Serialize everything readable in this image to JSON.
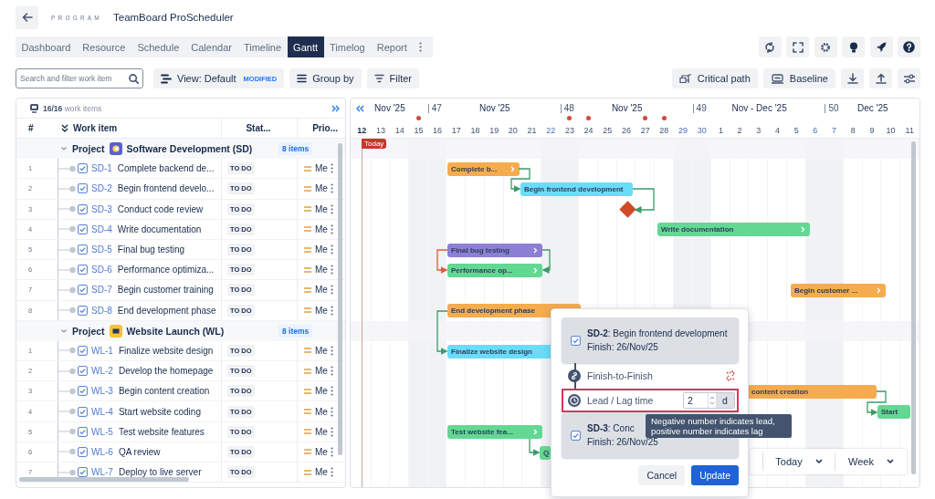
{
  "header": {
    "eyebrow": "PROGRAM",
    "title": "TeamBoard ProScheduler"
  },
  "tabs": [
    {
      "label": "Dashboard",
      "selected": false
    },
    {
      "label": "Resource",
      "selected": false
    },
    {
      "label": "Schedule",
      "selected": false
    },
    {
      "label": "Calendar",
      "selected": false
    },
    {
      "label": "Timeline",
      "selected": false
    },
    {
      "label": "Gantt",
      "selected": true
    },
    {
      "label": "Timelog",
      "selected": false
    },
    {
      "label": "Report",
      "selected": false
    }
  ],
  "toolbar": {
    "search": {
      "placeholder": "Search and filter work item"
    },
    "view": {
      "label": "View: Default",
      "badge": "MODIFIED"
    },
    "buttons": [
      {
        "kind": "group",
        "label": "Group by"
      },
      {
        "kind": "filter",
        "label": "Filter"
      }
    ],
    "right_buttons": [
      {
        "kind": "critical-path",
        "label": "Critical path"
      },
      {
        "kind": "baseline",
        "label": "Baseline"
      }
    ]
  },
  "grid": {
    "summary": "**16/16** work items",
    "columns": [
      "#",
      "Work item",
      "Stat...",
      "Prio..."
    ],
    "groups": [
      {
        "label": "Project",
        "name": "Software Development (SD)",
        "count": "8 items",
        "expanded": true,
        "color": "#5a5fd0",
        "items": [
          {
            "number": "1",
            "key": "SD-1",
            "title": "Complete backend de...",
            "status": "TO DO",
            "priority": "Me",
            "bar": {
              "kind": "task",
              "label": "Complete b...",
              "color": "#f5ac4e"
            }
          },
          {
            "number": "2",
            "key": "SD-2",
            "title": "Begin frontend develo...",
            "status": "TO DO",
            "priority": "Me",
            "bar": {
              "kind": "task",
              "label": "Begin frontend development",
              "color": "#6adcf8"
            }
          },
          {
            "number": "3",
            "key": "SD-3",
            "title": "Conduct code review",
            "status": "TO DO",
            "priority": "Me",
            "bar": {
              "kind": "milestone",
              "color": "#d04a2a"
            }
          },
          {
            "number": "4",
            "key": "SD-4",
            "title": "Write documentation",
            "status": "TO DO",
            "priority": "Me",
            "bar": {
              "kind": "task",
              "label": "Write documentation",
              "color": "#63d892"
            }
          },
          {
            "number": "5",
            "key": "SD-5",
            "title": "Final bug testing",
            "status": "TO DO",
            "priority": "Me",
            "bar": {
              "kind": "task",
              "label": "Final bug testing",
              "color": "#8c7fd4"
            }
          },
          {
            "number": "6",
            "key": "SD-6",
            "title": "Performance optimiza...",
            "status": "TO DO",
            "priority": "Me",
            "bar": {
              "kind": "task",
              "label": "Performance op...",
              "color": "#63d892"
            }
          },
          {
            "number": "7",
            "key": "SD-7",
            "title": "Begin customer training",
            "status": "TO DO",
            "priority": "Me",
            "bar": {
              "kind": "task",
              "label": "Begin customer ...",
              "color": "#f5ac4e"
            }
          },
          {
            "number": "8",
            "key": "SD-8",
            "title": "End development phase",
            "status": "TO DO",
            "priority": "Me",
            "bar": {
              "kind": "task",
              "label": "End development phase",
              "color": "#f5ac4e"
            }
          }
        ]
      },
      {
        "label": "Project",
        "name": "Website Launch (WL)",
        "count": "8 items",
        "expanded": true,
        "color": "#f5c33b",
        "items": [
          {
            "number": "1",
            "key": "WL-1",
            "title": "Finalize website design",
            "status": "TO DO",
            "priority": "Me",
            "bar": {
              "kind": "task",
              "label": "Finalize website design",
              "color": "#6adcf8"
            }
          },
          {
            "number": "2",
            "key": "WL-2",
            "title": "Develop the homepage",
            "status": "TO DO",
            "priority": "Me"
          },
          {
            "number": "3",
            "key": "WL-3",
            "title": "Begin content creation",
            "status": "TO DO",
            "priority": "Me",
            "bar": {
              "kind": "task",
              "label": "content creation",
              "color": "#f5ac4e"
            }
          },
          {
            "number": "4",
            "key": "WL-4",
            "title": "Start website coding",
            "status": "TO DO",
            "priority": "Me",
            "bar": {
              "kind": "task",
              "label": "Start",
              "color": "#63d892"
            }
          },
          {
            "number": "5",
            "key": "WL-5",
            "title": "Test website features",
            "status": "TO DO",
            "priority": "Me",
            "bar": {
              "kind": "task",
              "label": "Test website fea...",
              "color": "#63d892"
            }
          },
          {
            "number": "6",
            "key": "WL-6",
            "title": "QA review",
            "status": "TO DO",
            "priority": "Me",
            "bar": {
              "kind": "task",
              "label": "Q",
              "color": "#63d892"
            }
          },
          {
            "number": "7",
            "key": "WL-7",
            "title": "Deploy to live server",
            "status": "TO DO",
            "priority": "Me"
          }
        ]
      }
    ]
  },
  "timeline": {
    "today_label": "Today",
    "weeks": [
      {
        "month": "Nov '25",
        "days": [
          {
            "day": "12",
            "kind": "today",
            "shaded": false,
            "holiday": false
          },
          {
            "day": "13",
            "kind": "workday",
            "shaded": false,
            "holiday": false
          },
          {
            "day": "14",
            "kind": "workday",
            "shaded": false,
            "holiday": false
          },
          {
            "day": "15",
            "kind": "workday",
            "shaded": true,
            "holiday": true
          }
        ]
      },
      {
        "week": "47",
        "month": "Nov '25",
        "days": [
          {
            "day": "16",
            "kind": "workday",
            "shaded": true,
            "holiday": false
          },
          {
            "day": "17",
            "kind": "workday",
            "shaded": false,
            "holiday": false
          },
          {
            "day": "18",
            "kind": "workday",
            "shaded": false,
            "holiday": false
          },
          {
            "day": "19",
            "kind": "workday",
            "shaded": false,
            "holiday": false
          },
          {
            "day": "20",
            "kind": "workday",
            "shaded": false,
            "holiday": false
          },
          {
            "day": "21",
            "kind": "workday",
            "shaded": false,
            "holiday": false
          },
          {
            "day": "22",
            "kind": "weekend",
            "shaded": true,
            "holiday": false
          }
        ]
      },
      {
        "week": "48",
        "month": "Nov '25",
        "days": [
          {
            "day": "23",
            "kind": "workday",
            "shaded": true,
            "holiday": true
          },
          {
            "day": "24",
            "kind": "workday",
            "shaded": false,
            "holiday": true
          },
          {
            "day": "25",
            "kind": "workday",
            "shaded": false,
            "holiday": false
          },
          {
            "day": "26",
            "kind": "workday",
            "shaded": false,
            "holiday": false
          },
          {
            "day": "27",
            "kind": "workday",
            "shaded": false,
            "holiday": true
          },
          {
            "day": "28",
            "kind": "workday",
            "shaded": false,
            "holiday": true
          },
          {
            "day": "29",
            "kind": "weekend",
            "shaded": true,
            "holiday": false
          }
        ]
      },
      {
        "week": "49",
        "month": "Nov - Dec '25",
        "days": [
          {
            "day": "30",
            "kind": "weekend",
            "shaded": true,
            "holiday": false
          },
          {
            "day": "1",
            "kind": "workday",
            "shaded": false,
            "holiday": false
          },
          {
            "day": "2",
            "kind": "workday",
            "shaded": false,
            "holiday": false
          },
          {
            "day": "3",
            "kind": "workday",
            "shaded": false,
            "holiday": false
          },
          {
            "day": "4",
            "kind": "workday",
            "shaded": false,
            "holiday": false
          },
          {
            "day": "5",
            "kind": "workday",
            "shaded": false,
            "holiday": false
          },
          {
            "day": "6",
            "kind": "weekend",
            "shaded": true,
            "holiday": false
          }
        ]
      },
      {
        "week": "50",
        "month": "Dec '25",
        "days": [
          {
            "day": "7",
            "kind": "weekend",
            "shaded": true,
            "holiday": false
          },
          {
            "day": "8",
            "kind": "workday",
            "shaded": false,
            "holiday": false
          },
          {
            "day": "9",
            "kind": "workday",
            "shaded": false,
            "holiday": false
          },
          {
            "day": "10",
            "kind": "workday",
            "shaded": false,
            "holiday": false
          },
          {
            "day": "11",
            "kind": "workday",
            "shaded": false,
            "holiday": false
          }
        ]
      }
    ]
  },
  "view_controls": [
    {
      "label": "Today"
    },
    {
      "label": "Week"
    }
  ],
  "dependency_popup": {
    "source": {
      "line": "**SD-2**: Begin frontend development",
      "finish": "Finish: 26/Nov/25"
    },
    "link_type": "Finish-to-Finish",
    "lag": {
      "label": "Lead / Lag time",
      "value": "2",
      "unit": "d"
    },
    "tooltip": "Negative number indicates lead, positive number indicates lag",
    "target": {
      "line": "**SD-3**: Conc",
      "finish": "Finish: 26/Nov/25"
    },
    "buttons": [
      {
        "kind": "secondary",
        "label": "Cancel"
      },
      {
        "kind": "primary",
        "label": "Update"
      }
    ]
  }
}
